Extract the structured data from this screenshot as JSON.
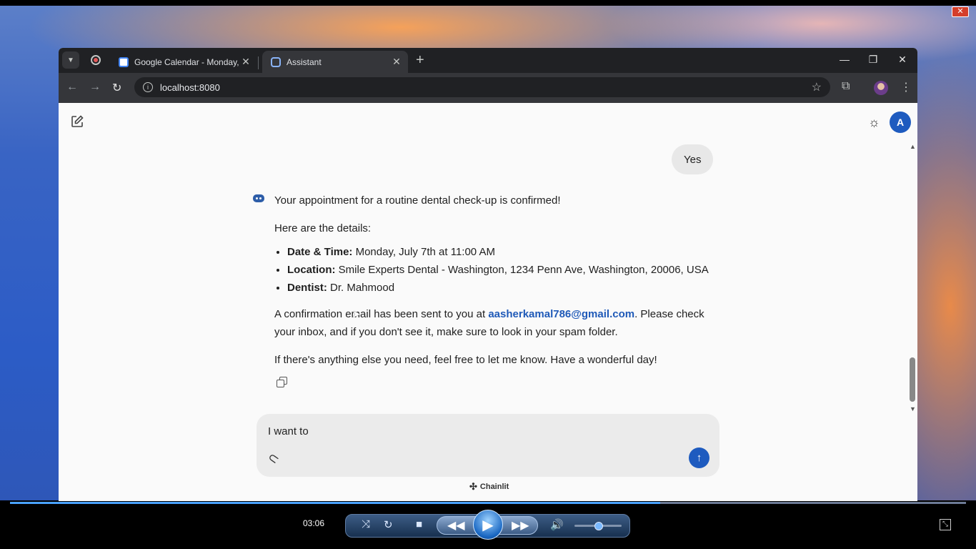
{
  "wallpaper": {
    "close_glyph": "✕"
  },
  "browser": {
    "tabs": [
      {
        "title": "Google Calendar - Monday, July",
        "icon": "google-calendar-icon"
      },
      {
        "title": "Assistant",
        "icon": "assistant-icon",
        "active": true
      }
    ],
    "address": "localhost:8080"
  },
  "chat": {
    "user_message": "Yes",
    "bot": {
      "headline": "Your appointment for a routine dental check-up is confirmed!",
      "intro": "Here are the details:",
      "details": [
        {
          "label": "Date & Time:",
          "value": " Monday, July 7th at 11:00 AM"
        },
        {
          "label": "Location:",
          "value": " Smile Experts Dental - Washington, 1234 Penn Ave, Washington, 20006, USA"
        },
        {
          "label": "Dentist:",
          "value": " Dr. Mahmood"
        }
      ],
      "confirm_pre": "A confirmation email has been sent to you at ",
      "email": "aasherkamal786@gmail.com",
      "confirm_post": ". Please check your inbox, and if you don't see it, make sure to look in your spam folder.",
      "closing": "If there's anything else you need, feel free to let me know. Have a wonderful day!"
    },
    "composer": {
      "value": "I want to "
    },
    "branding": "Chainlit",
    "user_avatar_letter": "A"
  },
  "player": {
    "timecode": "03:06",
    "progress": 0.68,
    "volume": 0.5
  },
  "colors": {
    "accent": "#1e5bbf",
    "link": "#1f5ab8"
  }
}
